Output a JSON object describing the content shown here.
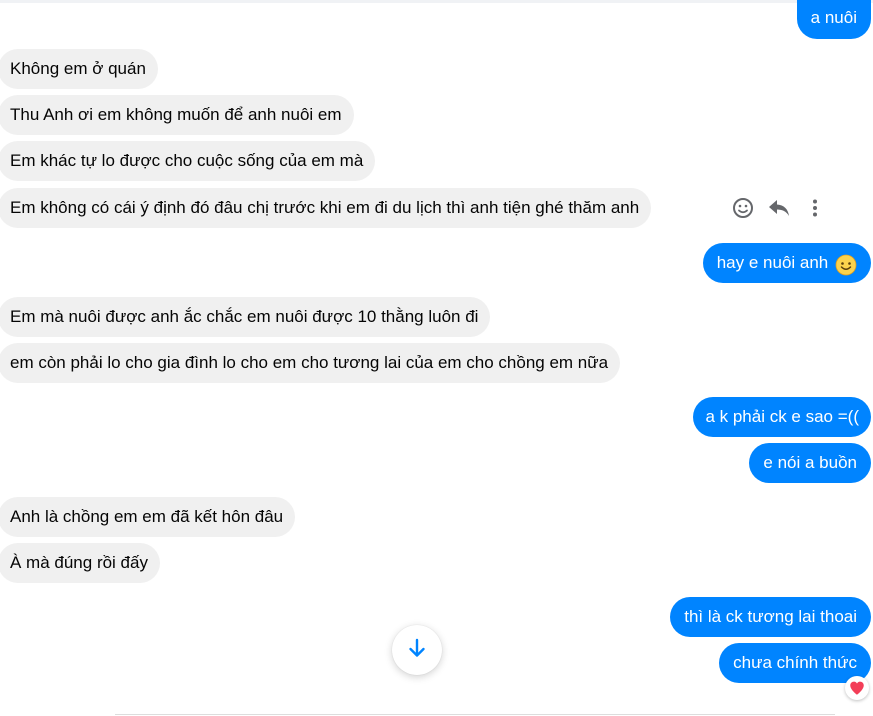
{
  "messages": [
    {
      "side": "out",
      "text": "a nuôi"
    },
    {
      "side": "in",
      "text": "Không em ở quán"
    },
    {
      "side": "in",
      "text": "Thu Anh ơi em không muốn để anh nuôi em"
    },
    {
      "side": "in",
      "text": "Em khác tự lo được cho cuộc sống của em mà"
    },
    {
      "side": "in",
      "text": "Em không có cái ý định đó đâu chị trước khi em đi du lịch thì anh tiện ghé thăm anh"
    },
    {
      "side": "out",
      "text": "hay e nuôi anh",
      "emoji": "smiling-face-icon"
    },
    {
      "side": "in",
      "text": "Em mà nuôi được anh ắc chắc em nuôi được 10 thằng luôn đi"
    },
    {
      "side": "in",
      "text": "em còn phải lo cho gia đình lo cho em cho tương lai của em cho chồng em nữa"
    },
    {
      "side": "out",
      "text": "a k phải ck e sao =(("
    },
    {
      "side": "out",
      "text": "e nói a buồn"
    },
    {
      "side": "in",
      "text": "Anh là chồng em em đã kết hôn đâu"
    },
    {
      "side": "in",
      "text": "À mà đúng rồi đấy"
    },
    {
      "side": "out",
      "text": "thì là ck tương lai thoai"
    },
    {
      "side": "out",
      "text": "chưa chính thức",
      "reaction": "heart-icon"
    }
  ],
  "message_actions": {
    "icons": [
      "smiley-icon",
      "reply-icon",
      "more-icon"
    ]
  },
  "scroll_button": {
    "icon": "arrow-down-icon"
  },
  "colors": {
    "outgoing_bubble": "#0084ff",
    "incoming_bubble": "#f0f0f0",
    "reaction_heart": "#f33e58"
  }
}
